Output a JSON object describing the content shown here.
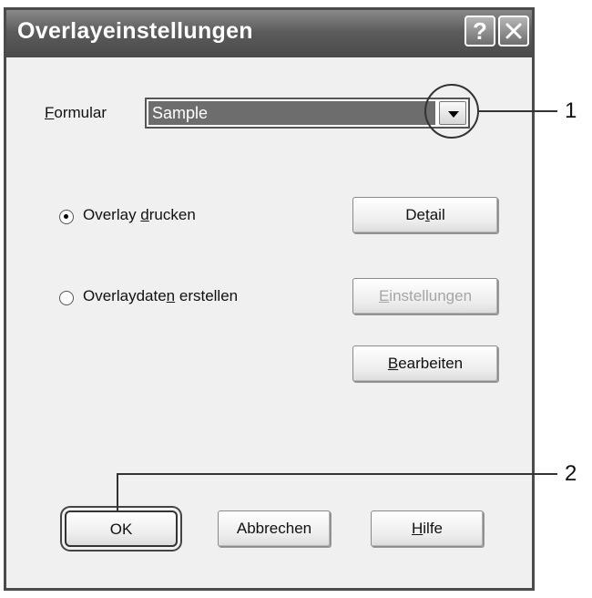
{
  "window": {
    "title": "Overlayeinstellungen",
    "help_glyph": "?"
  },
  "form": {
    "label_prefix": "",
    "label_underlined": "F",
    "label_rest": "ormular",
    "selected_value": "Sample"
  },
  "options": [
    {
      "prefix": "Overlay ",
      "underlined": "d",
      "rest": "rucken",
      "checked": true
    },
    {
      "prefix": "Overlaydate",
      "underlined": "n",
      "rest": " erstellen",
      "checked": false
    }
  ],
  "buttons": {
    "detail": {
      "prefix": "De",
      "underlined": "t",
      "rest": "ail"
    },
    "einstellungen": {
      "prefix": "",
      "underlined": "E",
      "rest": "instellungen"
    },
    "bearbeiten": {
      "prefix": "",
      "underlined": "B",
      "rest": "earbeiten"
    },
    "ok": {
      "label": "OK"
    },
    "abbrechen": {
      "label": "Abbrechen"
    },
    "hilfe": {
      "prefix": "",
      "underlined": "H",
      "rest": "ilfe"
    }
  },
  "callouts": [
    "1",
    "2"
  ]
}
